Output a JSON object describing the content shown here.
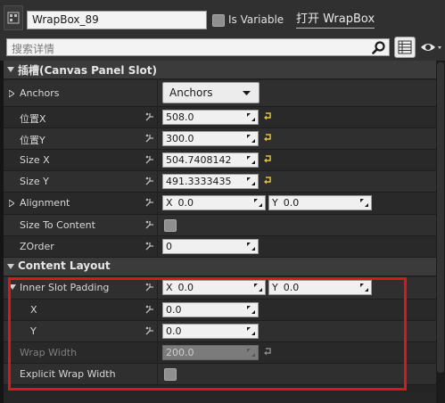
{
  "header": {
    "widget_name": "WrapBox_89",
    "is_variable_label": "Is Variable",
    "open_link": "打开 WrapBox",
    "search_placeholder": "搜索详情"
  },
  "slot_category": {
    "title": "插槽(Canvas Panel Slot)",
    "rows": [
      {
        "label": "Anchors",
        "dropdown": "Anchors"
      },
      {
        "label": "位置X",
        "value": "508.0"
      },
      {
        "label": "位置Y",
        "value": "300.0"
      },
      {
        "label": "Size X",
        "value": "504.7408142"
      },
      {
        "label": "Size Y",
        "value": "491.3333435"
      },
      {
        "label": "Alignment",
        "x_axis": "X",
        "x_value": "0.0",
        "y_axis": "Y",
        "y_value": "0.0"
      },
      {
        "label": "Size To Content"
      },
      {
        "label": "ZOrder",
        "value": "0"
      }
    ]
  },
  "content_category": {
    "title": "Content Layout",
    "rows": [
      {
        "label": "Inner Slot Padding",
        "x_axis": "X",
        "x_value": "0.0",
        "y_axis": "Y",
        "y_value": "0.0"
      },
      {
        "label": "X",
        "value": "0.0"
      },
      {
        "label": "Y",
        "value": "0.0"
      },
      {
        "label": "Wrap Width",
        "value": "200.0"
      },
      {
        "label": "Explicit Wrap Width"
      }
    ]
  },
  "colors": {
    "highlight_box": "#d7181f",
    "reset_arrow": "#e4c23a"
  }
}
